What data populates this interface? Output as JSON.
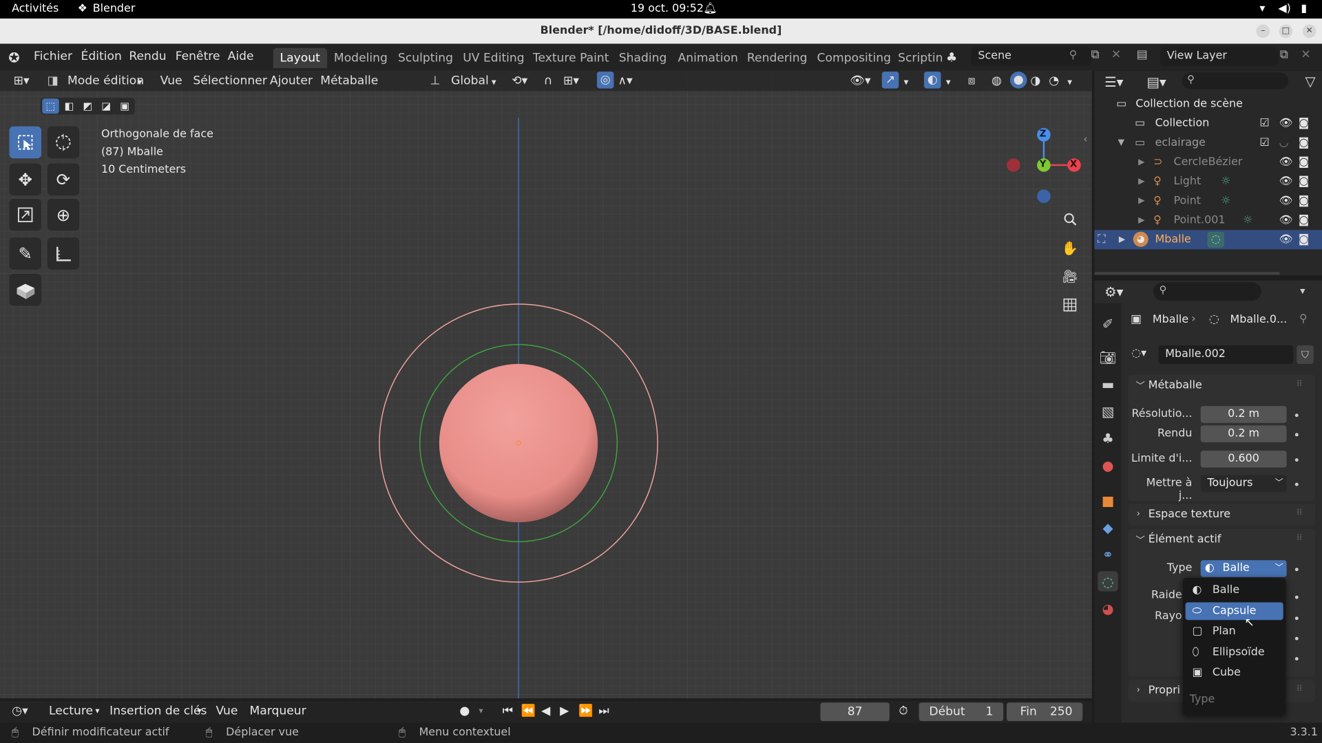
{
  "gnome": {
    "activities": "Activités",
    "app": "Blender",
    "clock": "19 oct.  09:52"
  },
  "window": {
    "title": "Blender* [/home/didoff/3D/BASE.blend]"
  },
  "menus": [
    "Fichier",
    "Édition",
    "Rendu",
    "Fenêtre",
    "Aide"
  ],
  "workspaces": [
    "Layout",
    "Modeling",
    "Sculpting",
    "UV Editing",
    "Texture Paint",
    "Shading",
    "Animation",
    "Rendering",
    "Compositing",
    "Scriptin"
  ],
  "scene": "Scene",
  "view_layer": "View Layer",
  "viewport_header": {
    "mode": "Mode édition",
    "menus": [
      "Vue",
      "Sélectionner",
      "Ajouter",
      "Métaballe"
    ],
    "orientation": "Global"
  },
  "overlay": {
    "view": "Orthogonale de face",
    "object": "(87) Mballe",
    "scale": "10 Centimeters"
  },
  "gizmo": {
    "z": "Z",
    "y": "Y",
    "x": "X"
  },
  "outliner": {
    "root": "Collection de scène",
    "items": [
      {
        "name": "Collection"
      },
      {
        "name": "eclairage"
      },
      {
        "name": "CercleBézier"
      },
      {
        "name": "Light"
      },
      {
        "name": "Point"
      },
      {
        "name": "Point.001"
      },
      {
        "name": "Mballe"
      }
    ]
  },
  "properties": {
    "breadcrumb_obj": "Mballe",
    "breadcrumb_data": "Mballe.0...",
    "datablock": "Mballe.002",
    "metaball_panel": "Métaballe",
    "fields": [
      {
        "label": "Résolutio...",
        "value": "0.2 m"
      },
      {
        "label": "Rendu",
        "value": "0.2 m"
      },
      {
        "label": "Limite d'i...",
        "value": "0.600"
      },
      {
        "label": "Mettre à j...",
        "value": "Toujours"
      }
    ],
    "texture_panel": "Espace texture",
    "active_panel": "Élément actif",
    "type_label": "Type",
    "type_value": "Balle",
    "raide_label": "Raide",
    "rayon_label": "Rayo",
    "propr_panel": "Propri"
  },
  "dropdown": {
    "items": [
      "Balle",
      "Capsule",
      "Plan",
      "Ellipsoïde",
      "Cube"
    ],
    "footer": "Type",
    "highlighted": 1
  },
  "timeline": {
    "playback": "Lecture",
    "keying": "Insertion de clés",
    "view": "Vue",
    "marker": "Marqueur",
    "frame": "87",
    "start_label": "Début",
    "start": "1",
    "end_label": "Fin",
    "end": "250"
  },
  "status": {
    "left": "Définir modificateur actif",
    "mid": "Déplacer vue",
    "right": "Menu contextuel",
    "version": "3.3.1"
  },
  "colors": {
    "accent": "#4772b3",
    "sphere": "#e88d88",
    "outer_circle": "#f0a29e",
    "inner_circle": "#3fa33f",
    "x_axis": "#e8434f",
    "y_axis": "#7fc832",
    "z_axis": "#4a8ee8"
  }
}
